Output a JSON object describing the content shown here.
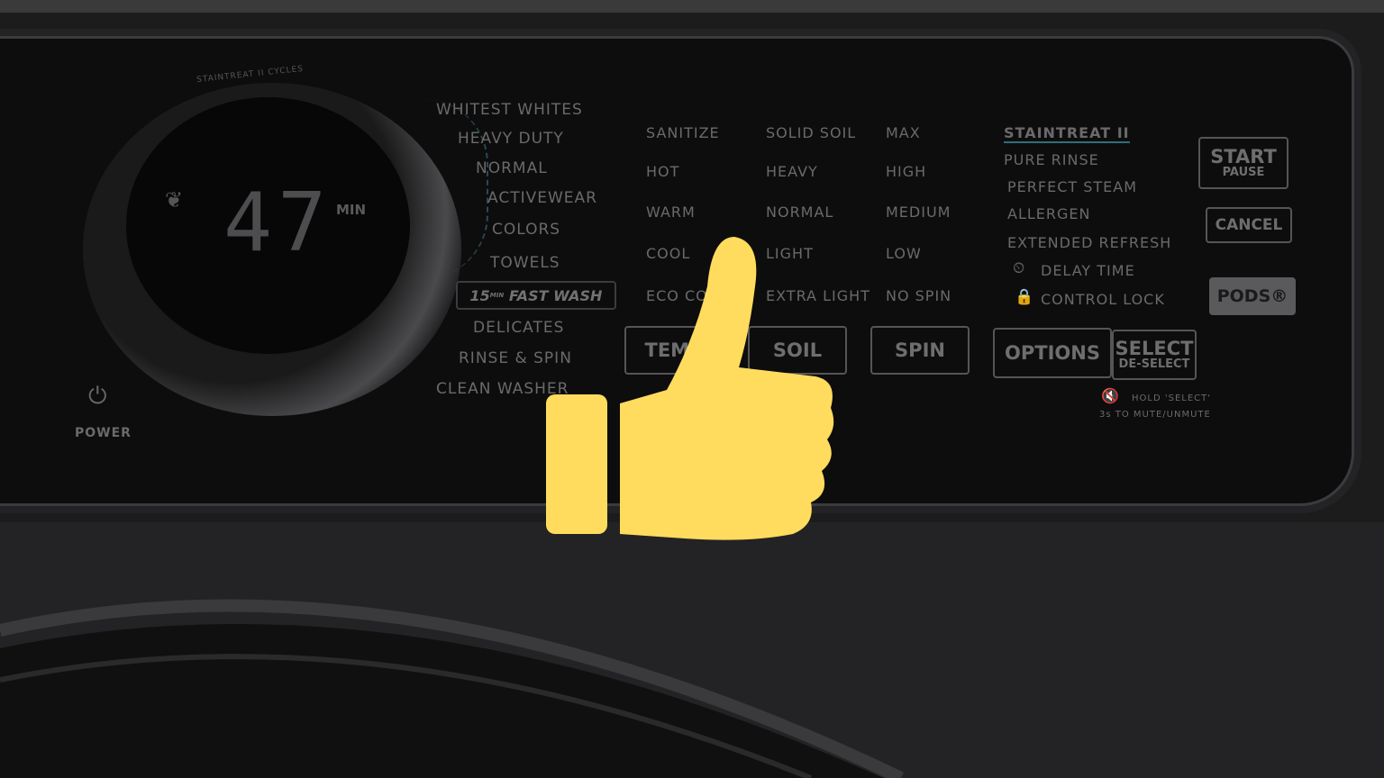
{
  "display": {
    "arc_label": "STAINTREAT II CYCLES",
    "time": "47",
    "unit": "MIN",
    "eco_icon": "leaf-icon"
  },
  "power": {
    "label": "POWER",
    "icon": "power-icon"
  },
  "cycles": [
    "WHITEST WHITES",
    "HEAVY DUTY",
    "NORMAL",
    "ACTIVEWEAR",
    "COLORS",
    "TOWELS",
    "DELICATES",
    "RINSE & SPIN",
    "CLEAN WASHER"
  ],
  "fast_wash": {
    "number": "15",
    "sup": "MIN",
    "label": "FAST WASH"
  },
  "temp": [
    "SANITIZE",
    "HOT",
    "WARM",
    "COOL",
    "ECO COLD"
  ],
  "soil": [
    "SOLID SOIL",
    "HEAVY",
    "NORMAL",
    "LIGHT",
    "EXTRA LIGHT"
  ],
  "spin": [
    "MAX",
    "HIGH",
    "MEDIUM",
    "LOW",
    "NO SPIN"
  ],
  "options": [
    "STAINTREAT II",
    "PURE RINSE",
    "PERFECT STEAM",
    "ALLERGEN",
    "EXTENDED REFRESH",
    "DELAY TIME",
    "CONTROL LOCK"
  ],
  "buttons": {
    "temp": "TEMP",
    "soil": "SOIL",
    "spin": "SPIN",
    "options": "OPTIONS",
    "select": "SELECT",
    "deselect": "DE-SELECT",
    "start": "START",
    "pause": "PAUSE",
    "cancel": "CANCEL",
    "pods": "PODS®"
  },
  "mute": {
    "line1": "HOLD 'SELECT'",
    "line2": "3s TO MUTE/UNMUTE"
  },
  "overlay": {
    "icon": "thumbs-up-icon",
    "color": "#ffdc5d"
  },
  "accent": "#2f6e78"
}
